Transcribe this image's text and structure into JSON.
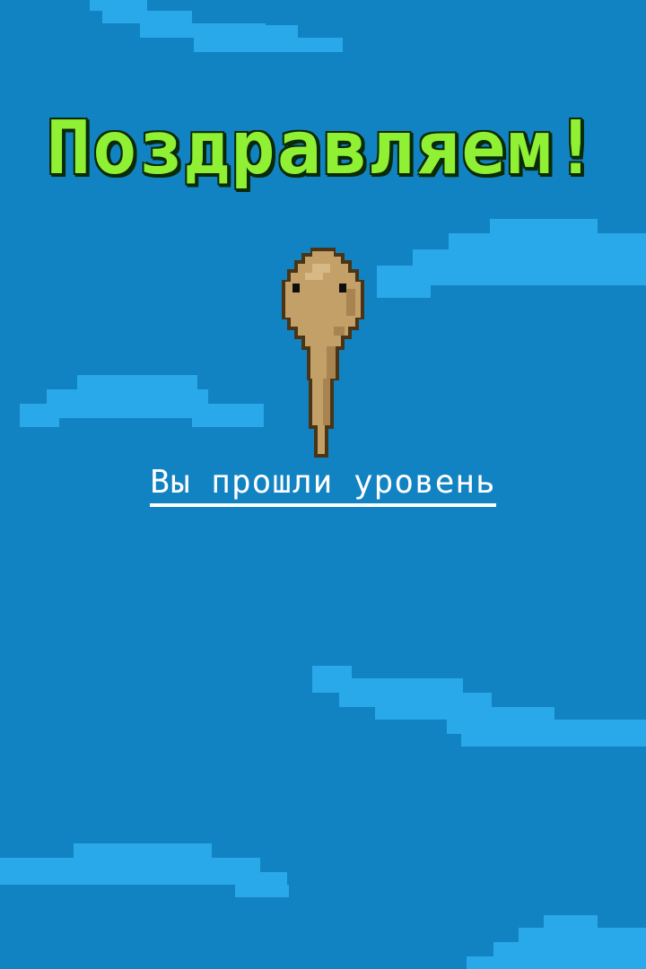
{
  "screen": {
    "title": "Поздравляем!",
    "subtitle": "Вы прошли уровень"
  },
  "colors": {
    "background": "#1283c2",
    "cloud": "#29a8ea",
    "title_text": "#8ff034",
    "title_outline": "#0a2a08",
    "subtitle_text": "#ffffff",
    "sperm_body": "#c2a068",
    "sperm_outline": "#4a3416"
  },
  "sprites": {
    "player": "sperm-sprite",
    "background_decor": "pixel-cloud"
  }
}
